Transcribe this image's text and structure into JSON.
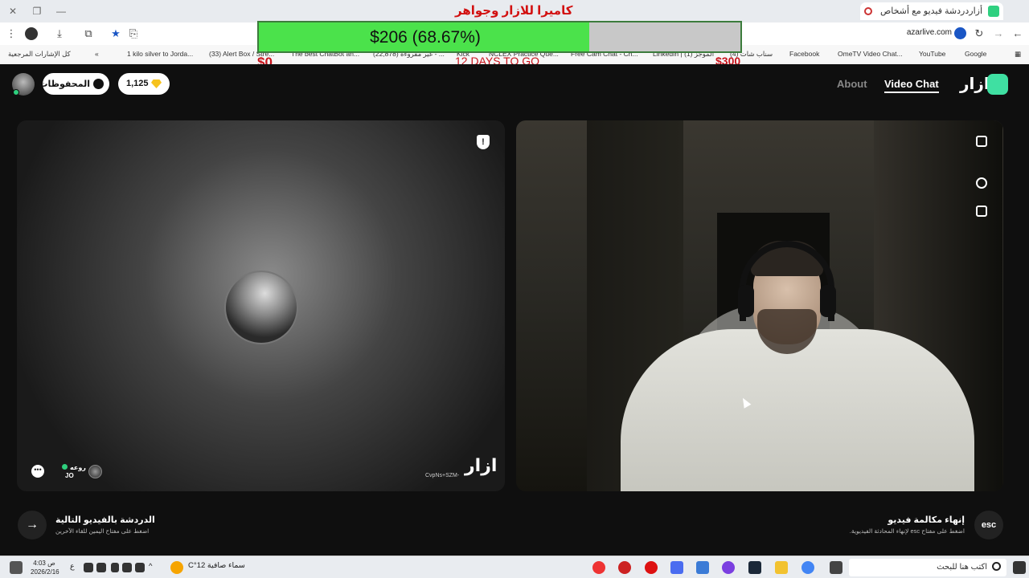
{
  "browser": {
    "tab_title": "أزاردردشة فيديو مع أشخاص",
    "url": "azarlive.com",
    "bookmarks": [
      {
        "label": "كل الإشارات المرجعية"
      },
      {
        "label": "1 kilo silver to Jorda..."
      },
      {
        "label": "(33) Alert Box / Stre..."
      },
      {
        "label": "The best ChatBot an..."
      },
      {
        "label": "غير مقروءة (22,878) - ..."
      },
      {
        "label": "Kick"
      },
      {
        "label": "NCLEX Practice Que..."
      },
      {
        "label": "Free Cam Chat - Ch..."
      },
      {
        "label": "LinkedIn | الموجز (1)"
      },
      {
        "label": "سناب شات (4)"
      },
      {
        "label": "Facebook"
      },
      {
        "label": "OmeTV Video Chat..."
      },
      {
        "label": "YouTube"
      },
      {
        "label": "Google"
      }
    ]
  },
  "overlay": {
    "goal_title": "كاميرا للازار وجواهر",
    "progress_label": "$206 (68.67%)",
    "progress_fraction": 0.6867,
    "goal_low": "$0",
    "goal_high": "$300",
    "days_left": "12 DAYS TO GO"
  },
  "header": {
    "saved_label": "المحفوظات",
    "gems_count": "1,125",
    "nav_about": "About",
    "nav_video_chat": "Video Chat",
    "logo_text": "ازار"
  },
  "peer": {
    "name": "روعه",
    "country": "JO",
    "watermark": "ازار",
    "watermark_id": "CvpNs+SZM-"
  },
  "footer": {
    "next_title": "الدردشة بالفيديو التالية",
    "next_sub": "اضغط على مفتاح اليمين للقاء الآخرين",
    "end_title": "إنهاء مكالمة فيديو",
    "end_sub": "اضغط على مفتاح esc لإنهاء المحادثة الفيديوية.",
    "esc_label": "esc"
  },
  "taskbar": {
    "search_placeholder": "اكتب هنا للبحث",
    "weather": "سماء صافية  12°C",
    "time": "4:03 ص",
    "date": "2026/2/16",
    "lang": "ع"
  },
  "colors": {
    "brand_green": "#3fe0a2",
    "progress_green": "#4be24b",
    "goal_red": "#d21010"
  }
}
